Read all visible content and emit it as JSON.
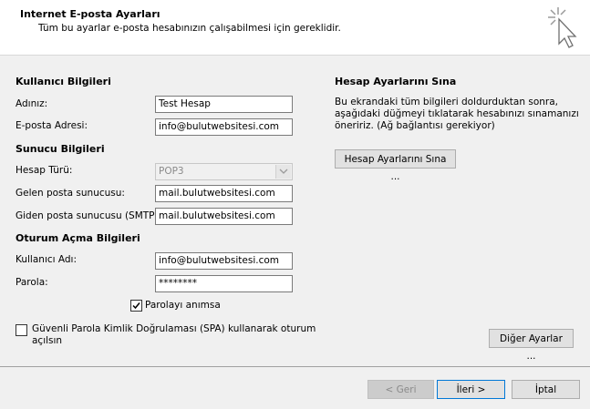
{
  "header": {
    "title": "Internet E-posta Ayarları",
    "subtitle": "Tüm bu ayarlar e-posta hesabınızın çalışabilmesi için gereklidir."
  },
  "user_info": {
    "section_title": "Kullanıcı Bilgileri",
    "name_label": "Adınız:",
    "name_value": "Test Hesap",
    "email_label": "E-posta Adresi:",
    "email_value": "info@bulutwebsitesi.com"
  },
  "server_info": {
    "section_title": "Sunucu Bilgileri",
    "account_type_label": "Hesap Türü:",
    "account_type_value": "POP3",
    "incoming_label": "Gelen posta sunucusu:",
    "incoming_value": "mail.bulutwebsitesi.com",
    "outgoing_label": "Giden posta sunucusu (SMTP):",
    "outgoing_value": "mail.bulutwebsitesi.com"
  },
  "logon_info": {
    "section_title": "Oturum Açma Bilgileri",
    "username_label": "Kullanıcı Adı:",
    "username_value": "info@bulutwebsitesi.com",
    "password_label": "Parola:",
    "password_value": "********",
    "remember_label": "Parolayı anımsa",
    "remember_checked": true,
    "spa_label_line1": "Güvenli Parola Kimlik Doğrulaması (SPA) kullanarak oturum",
    "spa_label_line2": "açılsın",
    "spa_checked": false
  },
  "test_settings": {
    "section_title": "Hesap Ayarlarını Sına",
    "description": "Bu ekrandaki tüm bilgileri doldurduktan sonra, aşağıdaki düğmeyi tıklatarak hesabınızı sınamanızı öneririz. (Ağ bağlantısı gerekiyor)",
    "test_button": "Hesap Ayarlarını Sına ...",
    "more_settings_button": "Diğer Ayarlar ..."
  },
  "footer": {
    "back_button": "< Geri",
    "next_button": "İleri >",
    "cancel_button": "İptal"
  },
  "icons": {
    "wizard": "wizard-cursor-sparkle-icon",
    "check": "checkmark-icon",
    "dropdown": "chevron-down-icon"
  },
  "colors": {
    "header_bg": "#ffffff",
    "body_bg": "#f0f0f0",
    "default_button_border": "#0078d7"
  }
}
